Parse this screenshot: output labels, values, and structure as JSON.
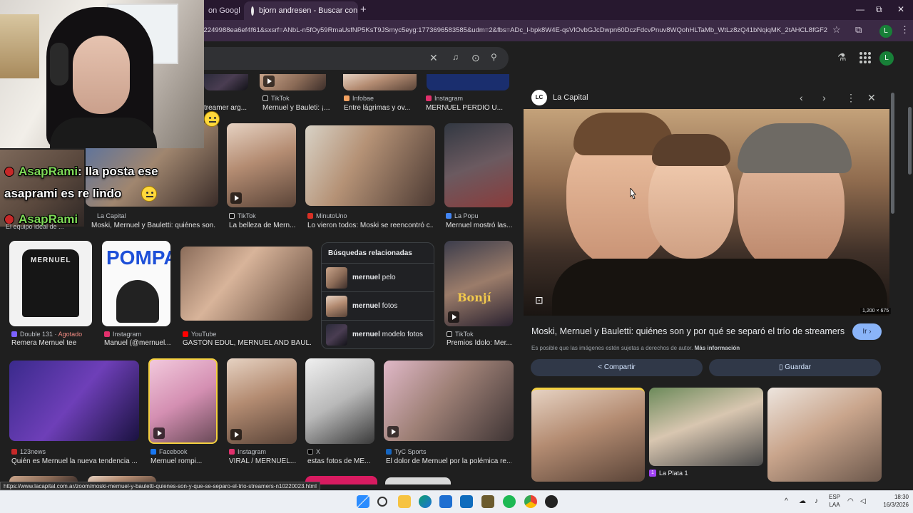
{
  "tabs": [
    {
      "title": "on Googl",
      "close": "×"
    },
    {
      "title": "bjorn andresen - Buscar con Go",
      "close": "×"
    }
  ],
  "new_tab": "+",
  "window_controls": {
    "minimize": "—",
    "restore": "⧉",
    "close": "✕"
  },
  "url": "=2249988ea6ef4f61&sxsrf=ANbL-n5fOy59RmaUsfNP5KsT9JSmyc5eyg:1773696583585&udm=2&fbs=ADc_l-bpk8W4E-qsVlOvbGJcDwpn60DczFdcvPnuv8WQohHLTaMb_WtLz8zQ41bNqiqMK_2tAHCL8fGF2xU6_n...",
  "profile_initial": "L",
  "search_icons": {
    "clear": "✕",
    "voice": "🎤",
    "lens": "⊙",
    "search": "🔍"
  },
  "chat": {
    "line1_user": "AsapRami",
    "line1_text": ": lla posta ese",
    "line2_text": "asaprami es re lindo",
    "line3_user": "AsapRami"
  },
  "results": [
    {
      "source": "TikTok",
      "caption": "Mernuel y Bauleti: ¡..."
    },
    {
      "source": "Infobae",
      "caption": "Entre lágrimas y ov..."
    },
    {
      "source": "Instagram",
      "caption": "MERNUEL PERDIÓ U..."
    },
    {
      "source": "",
      "caption": "treamer arg..."
    },
    {
      "source": "TikTok",
      "caption": "La belleza de Mern..."
    },
    {
      "source": "MinutoUno",
      "caption": "Lo vieron todos: Moski se reencontró c..."
    },
    {
      "source": "La Popu",
      "caption": "Mernuel mostró las..."
    },
    {
      "source": "TikTok",
      "caption": "El equipo ideal de ..."
    },
    {
      "source": "La Capital",
      "caption": "Moski, Mernuel y Bauletti: quiénes son..."
    },
    {
      "source": "Double 131",
      "source_extra": "Agotado",
      "caption": "Remera Mernuel tee"
    },
    {
      "source": "Instagram",
      "caption": "Manuel (@mernuel..."
    },
    {
      "source": "YouTube",
      "caption": "GASTÓN EDUL, MERNUEL AND BAUL..."
    },
    {
      "source": "TikTok",
      "caption": "Premios Ídolo: Mer..."
    },
    {
      "source": "123news",
      "caption": "Quién es Mernuel la nueva tendencia ..."
    },
    {
      "source": "Facebook",
      "caption": "Mernuel rompi..."
    },
    {
      "source": "Instagram",
      "caption": "VIRAL / MERNUEL..."
    },
    {
      "source": "X",
      "caption": "estas fotos de ME..."
    },
    {
      "source": "TyC Sports",
      "caption": "El dolor de Mernuel por la polémica re..."
    }
  ],
  "thumb_text": {
    "tee": "MERNUEL",
    "pompa": "POMPA",
    "tiktok_overlay": "Bonjí"
  },
  "related": {
    "heading": "Búsquedas relacionadas",
    "items": [
      {
        "prefix": "mernuel",
        "suffix": " pelo"
      },
      {
        "prefix": "mernuel",
        "suffix": " fotos"
      },
      {
        "prefix": "mernuel",
        "suffix": " modelo fotos"
      }
    ]
  },
  "panel": {
    "logo": "LC",
    "site": "La Capital",
    "dims": "1,200 × 675",
    "title": "Moski, Mernuel y Bauletti: quiénes son y por qué se separó el trío de streamers",
    "visit": "Ir ›",
    "copyright": "Es posible que las imágenes estén sujetas a derechos de autor.",
    "more_info": "Más información",
    "share": "Compartir",
    "save": "Guardar",
    "related_fav": "1",
    "related_source": "La Plata 1"
  },
  "status_url": "https://www.lacapital.com.ar/zoom/moski-mernuel-y-bauletti-quienes-son-y-que-se-separo-el-trio-streamers-n10220023.html",
  "taskbar": {
    "lang_top": "ESP",
    "lang_bottom": "LAA",
    "time": "18:30",
    "date": "16/3/2026"
  }
}
